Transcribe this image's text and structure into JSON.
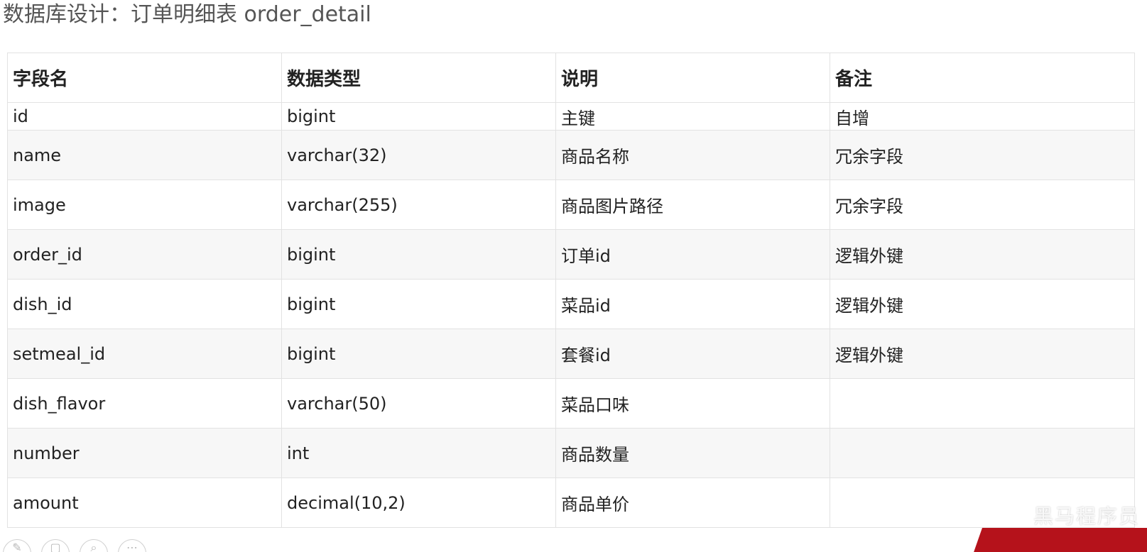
{
  "title": "数据库设计：订单明细表 order_detail",
  "table": {
    "headers": [
      "字段名",
      "数据类型",
      "说明",
      "备注"
    ],
    "rows": [
      [
        "id",
        "bigint",
        "主键",
        "自增"
      ],
      [
        "name",
        "varchar(32)",
        "商品名称",
        "冗余字段"
      ],
      [
        "image",
        "varchar(255)",
        "商品图片路径",
        "冗余字段"
      ],
      [
        "order_id",
        "bigint",
        "订单id",
        "逻辑外键"
      ],
      [
        "dish_id",
        "bigint",
        "菜品id",
        "逻辑外键"
      ],
      [
        "setmeal_id",
        "bigint",
        "套餐id",
        "逻辑外键"
      ],
      [
        "dish_flavor",
        "varchar(50)",
        "菜品口味",
        ""
      ],
      [
        "number",
        "int",
        "商品数量",
        ""
      ],
      [
        "amount",
        "decimal(10,2)",
        "商品单价",
        ""
      ]
    ]
  },
  "toolbar": {
    "icons": [
      "pen-icon",
      "copy-icon",
      "zoom-icon",
      "more-icon"
    ]
  },
  "watermark": "黑马程序员",
  "colors": {
    "title": "#555555",
    "grid": "#e2e2e2",
    "stripe": "#f7f7f7",
    "banner": "#b5121b"
  }
}
